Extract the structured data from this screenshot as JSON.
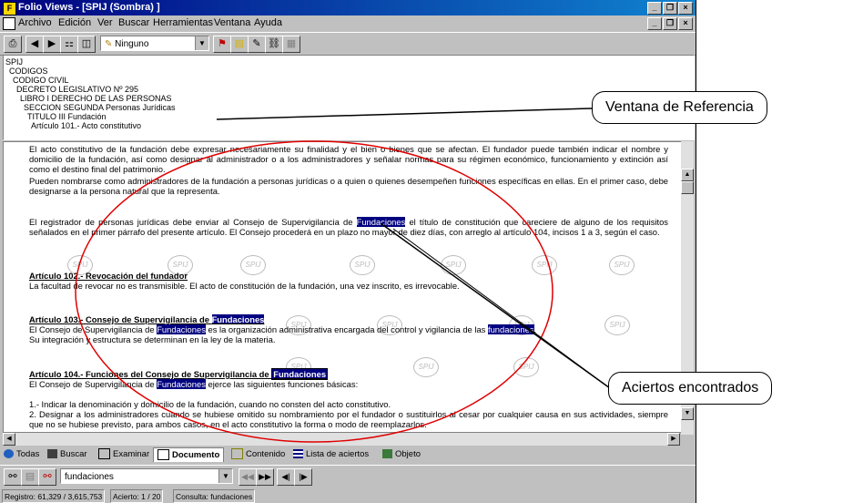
{
  "window": {
    "title": "Folio Views - [SPIJ (Sombra) ]"
  },
  "menu": [
    {
      "label": "Archivo"
    },
    {
      "label": "Edición"
    },
    {
      "label": "Ver"
    },
    {
      "label": "Buscar"
    },
    {
      "label": "Herramientas"
    },
    {
      "label": "Ventana"
    },
    {
      "label": "Ayuda"
    }
  ],
  "toolbar": {
    "highlighter_value": "Ninguno"
  },
  "reference": {
    "lines": [
      "SPIJ",
      "CODIGOS",
      "CODIGO CIVIL",
      "DECRETO LEGISLATIVO Nº 295",
      "LIBRO I DERECHO DE LAS PERSONAS",
      "SECCION SEGUNDA Personas Jurídicas",
      "TITULO III Fundación",
      "Artículo 101.- Acto constitutivo"
    ]
  },
  "document": {
    "p1": "El acto constitutivo de la fundación debe expresar necesariamente su finalidad y el bien o bienes que se afectan. El fundador puede también indicar el nombre y domicilio de la fundación, así como designar al administrador o a los administradores y señalar normas para su régimen económico, funcionamiento y extinción así como el destino final del patrimonio.",
    "p2": "Pueden nombrarse como administradores de la fundación a personas jurídicas o a quien o quienes desempeñen funciones específicas en ellas. En el primer caso, debe designarse a la persona natural que la representa.",
    "p3a": "El registrador de personas jurídicas debe enviar al Consejo de Supervigilancia de ",
    "p3hit": "Fundaciones",
    "p3b": " el título de constitución que careciere de alguno de los requisitos señalados en el primer párrafo del presente artículo.  El Consejo procederá en un plazo no mayor de diez días, con arreglo al artículo 104, incisos 1 a 3, según el caso.",
    "a102_heading": "Artículo 102.- Revocación del fundador",
    "a102_text": "La facultad de revocar no es transmisible. El acto de constitución de la fundación, una vez inscrito, es irrevocable.",
    "a103_heading": "Artículo 103.- Consejo de Supervigilancia de ",
    "a103_heading_hit": "Fundaciones",
    "a103_t1": "El Consejo de Supervigilancia de ",
    "a103_hit1": "Fundaciones",
    "a103_t2": " es la organización administrativa encargada del control y vigilancia de las ",
    "a103_hit2": "fundaciones",
    "a103_t3": ".",
    "a103_t4": "Su integración y estructura se determinan en la ley de la materia.",
    "a104_heading": "Artículo 104.- Funciones del Consejo de Supervigilancia de ",
    "a104_heading_hit": "Fundaciones",
    "a104_t1": "El Consejo de Supervigilancia de ",
    "a104_hit1": "Fundaciones",
    "a104_t2": " ejerce las siguientes funciones básicas:",
    "a104_i1": "1.- Indicar la denominación y domicilio de la fundación, cuando no consten del acto constitutivo.",
    "a104_i2": "2. Designar a los administradores cuando se hubiese omitido su nombramiento por el fundador o sustituirlos al cesar por cualquier causa en sus actividades, siempre que no se hubiese previsto, para ambos casos, en el acto constitutivo la forma o modo de reemplazarlos.",
    "watermark": "SPIJ"
  },
  "tabs": [
    {
      "label": "Todas"
    },
    {
      "label": "Buscar"
    },
    {
      "label": "Examinar"
    },
    {
      "label": "Documento"
    },
    {
      "label": "Contenido"
    },
    {
      "label": "Lista de aciertos"
    },
    {
      "label": "Objeto"
    }
  ],
  "search": {
    "query": "fundaciones"
  },
  "status": {
    "registro": "Registro: 61,329 / 3,615,753",
    "acierto": "Acierto: 1 / 20",
    "consulta": "Consulta: fundaciones"
  },
  "annotations": {
    "reference_callout": "Ventana de Referencia",
    "hits_callout": "Aciertos encontrados"
  }
}
